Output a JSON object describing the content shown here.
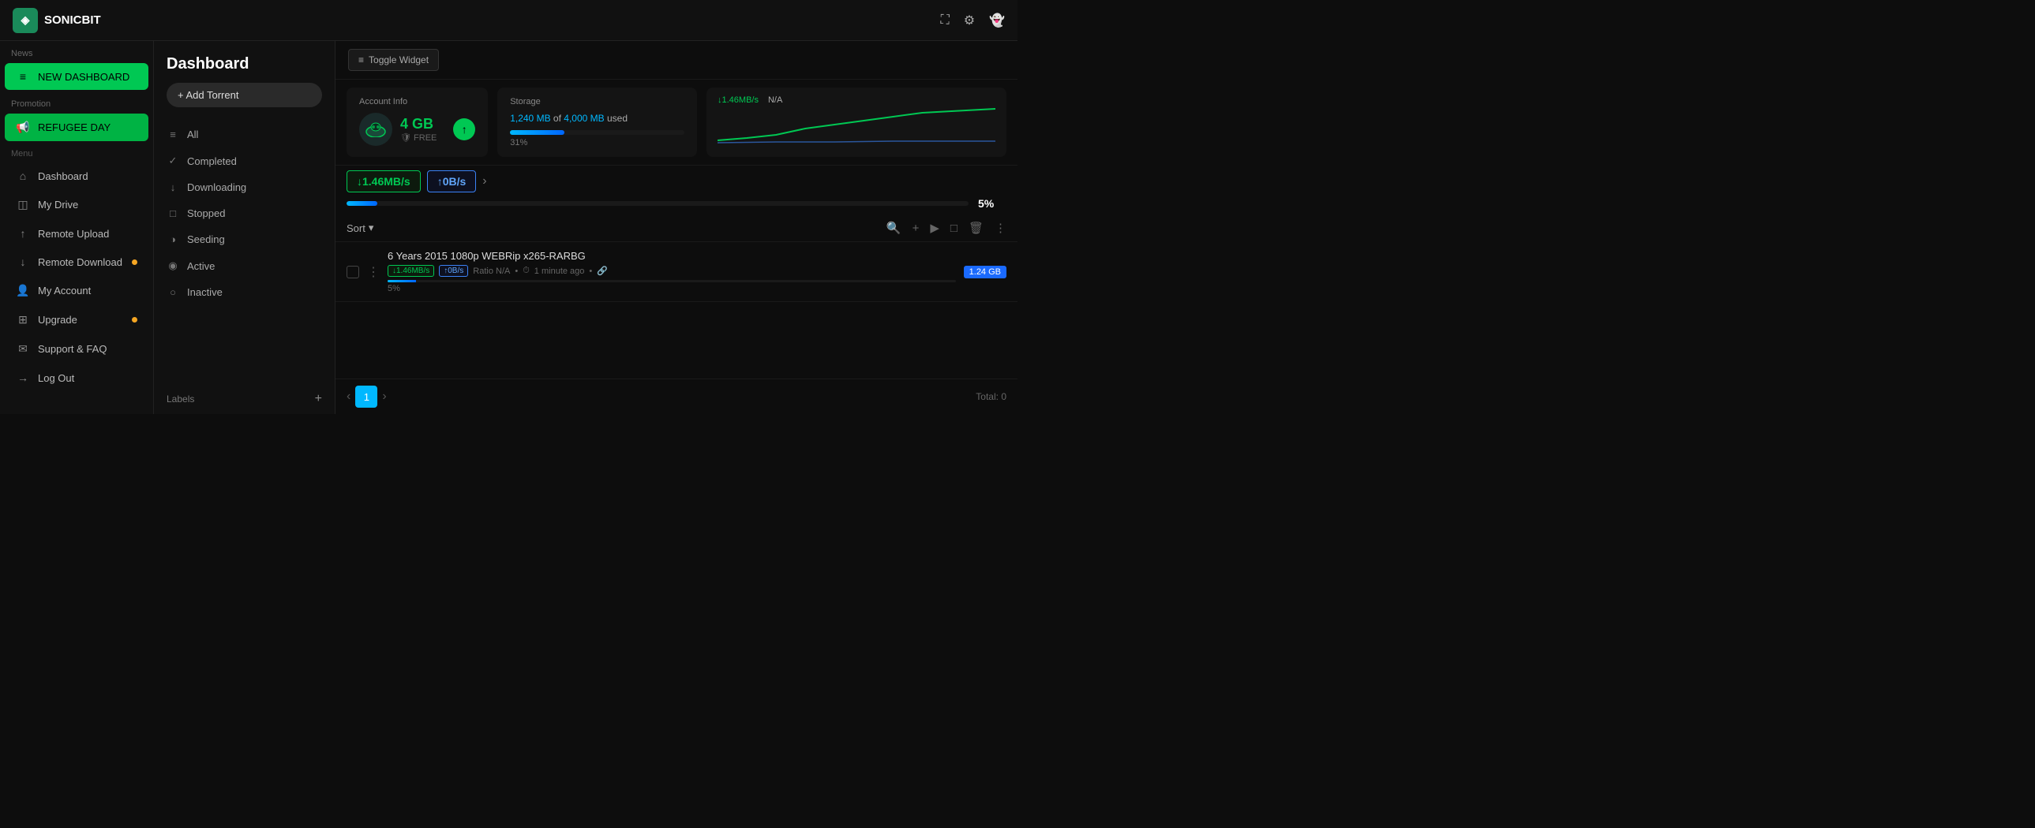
{
  "app": {
    "name": "SONICBIT",
    "logo_icon": "◈"
  },
  "topbar": {
    "expand_icon": "⛶",
    "settings_icon": "⚙",
    "user_icon": "👻"
  },
  "sidebar": {
    "sections": [
      {
        "label": "News",
        "items": [
          {
            "id": "new-dashboard",
            "label": "NEW DASHBOARD",
            "icon": "≡",
            "active": true,
            "style": "active-green"
          }
        ]
      },
      {
        "label": "Promotion",
        "items": [
          {
            "id": "refugee-day",
            "label": "REFUGEE DAY",
            "icon": "📢",
            "style": "promo-green"
          }
        ]
      },
      {
        "label": "Menu",
        "items": [
          {
            "id": "dashboard",
            "label": "Dashboard",
            "icon": "⌂",
            "style": ""
          },
          {
            "id": "my-drive",
            "label": "My Drive",
            "icon": "◫",
            "style": ""
          },
          {
            "id": "remote-upload",
            "label": "Remote Upload",
            "icon": "↑",
            "style": ""
          },
          {
            "id": "remote-download",
            "label": "Remote Download",
            "icon": "↓",
            "style": "",
            "badge": true
          },
          {
            "id": "my-account",
            "label": "My Account",
            "icon": "👤",
            "style": ""
          },
          {
            "id": "upgrade",
            "label": "Upgrade",
            "icon": "+",
            "style": "",
            "badge": true
          },
          {
            "id": "support-faq",
            "label": "Support & FAQ",
            "icon": "✉",
            "style": ""
          },
          {
            "id": "log-out",
            "label": "Log Out",
            "icon": "→",
            "style": ""
          }
        ]
      }
    ]
  },
  "mid_panel": {
    "title": "Dashboard",
    "add_button": "+ Add Torrent",
    "filters": [
      {
        "id": "all",
        "label": "All",
        "icon": "≡"
      },
      {
        "id": "completed",
        "label": "Completed",
        "icon": "✓"
      },
      {
        "id": "downloading",
        "label": "Downloading",
        "icon": "↓"
      },
      {
        "id": "stopped",
        "label": "Stopped",
        "icon": "□"
      },
      {
        "id": "seeding",
        "label": "Seeding",
        "icon": "◑"
      },
      {
        "id": "active",
        "label": "Active",
        "icon": "◉"
      },
      {
        "id": "inactive",
        "label": "Inactive",
        "icon": "○"
      }
    ],
    "labels_section": "Labels",
    "labels_add": "+"
  },
  "content": {
    "toggle_widget": "Toggle Widget",
    "account_info": {
      "title": "Account Info",
      "storage_gb": "4 GB",
      "plan": "FREE"
    },
    "storage": {
      "title": "Storage",
      "used_mb": "1,240 MB",
      "total_mb": "4,000 MB",
      "label": "used",
      "percent": "31%",
      "bar_width": "31"
    },
    "speed_widget": {
      "down_speed": "↓1.46MB/s",
      "up_speed": "N/A"
    },
    "speed_display": {
      "download": "↓1.46MB/s",
      "upload": "↑0B/s"
    },
    "progress": {
      "percent": "5%",
      "bar_width": "5"
    },
    "sort_label": "Sort",
    "list_actions": {
      "search": "🔍",
      "add": "+",
      "play": "▶",
      "square": "□",
      "delete": "🗑",
      "more": "⋮"
    },
    "torrents": [
      {
        "name": "6 Years 2015 1080p WEBRip x265-RARBG",
        "speed_down": "↓1.46MB/s",
        "speed_up": "↑0B/s",
        "ratio": "Ratio N/A",
        "time": "1 minute ago",
        "size": "1.24 GB",
        "progress": "5"
      }
    ],
    "pagination": {
      "current_page": "1",
      "prev_icon": "‹",
      "next_icon": "›",
      "total_label": "Total: 0"
    }
  }
}
